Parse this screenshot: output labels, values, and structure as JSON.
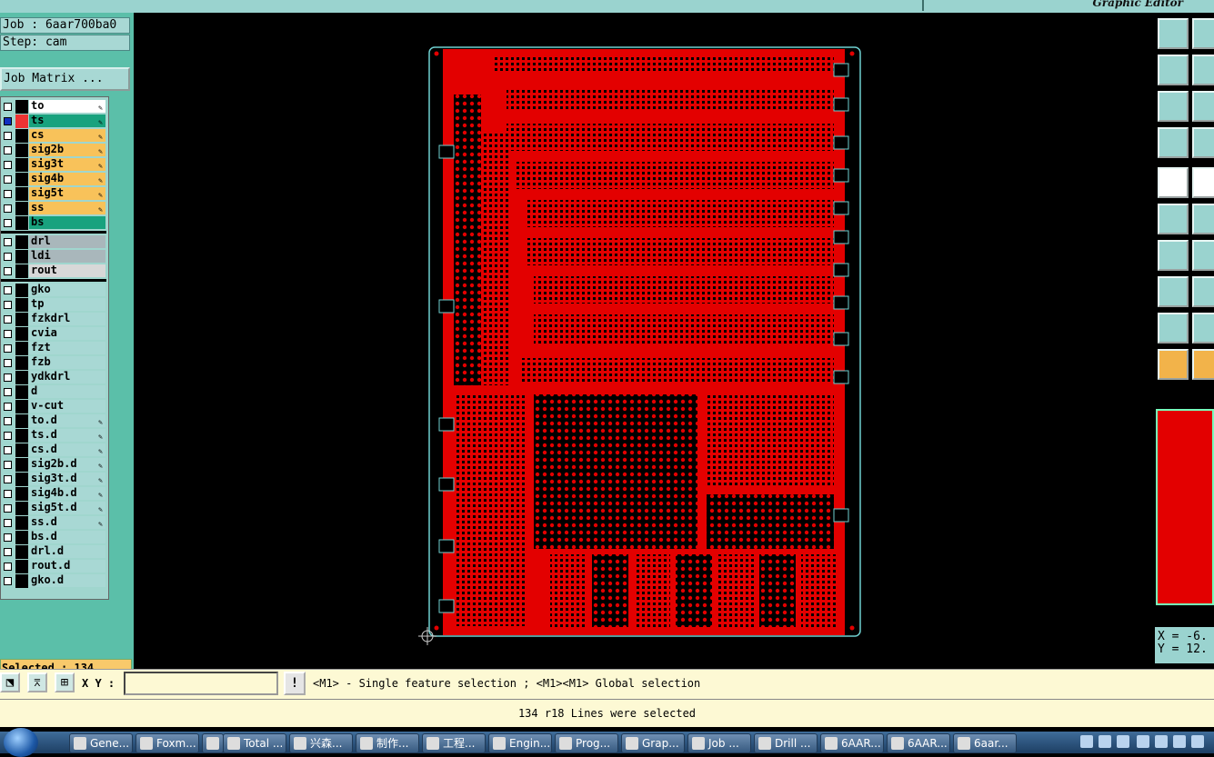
{
  "app": {
    "title": "Graphic Editor",
    "job": "Job : 6aar700ba0",
    "step": "Step: cam",
    "job_matrix": "Job Matrix ..."
  },
  "layers": {
    "board": [
      {
        "name": "to",
        "color": "#ffffff",
        "pen": true,
        "checked": false,
        "active": false
      },
      {
        "name": "ts",
        "color": "#18a27e",
        "pen": true,
        "checked": true,
        "active": true
      },
      {
        "name": "cs",
        "color": "#f8c25a",
        "pen": true,
        "checked": false,
        "active": false
      },
      {
        "name": "sig2b",
        "color": "#f8c25a",
        "pen": true,
        "checked": false,
        "active": false
      },
      {
        "name": "sig3t",
        "color": "#f8c25a",
        "pen": true,
        "checked": false,
        "active": false
      },
      {
        "name": "sig4b",
        "color": "#f8c25a",
        "pen": true,
        "checked": false,
        "active": false
      },
      {
        "name": "sig5t",
        "color": "#f8c25a",
        "pen": true,
        "checked": false,
        "active": false
      },
      {
        "name": "ss",
        "color": "#f8c25a",
        "pen": true,
        "checked": false,
        "active": false
      },
      {
        "name": "bs",
        "color": "#18a27e",
        "pen": false,
        "checked": false,
        "active": false
      }
    ],
    "drill": [
      {
        "name": "drl",
        "color": "#a9b7bb",
        "pen": false
      },
      {
        "name": "ldi",
        "color": "#a9b7bb",
        "pen": false
      },
      {
        "name": "rout",
        "color": "#d8d8d8",
        "pen": false
      }
    ],
    "misc": [
      {
        "name": "gko",
        "pen": false
      },
      {
        "name": "tp",
        "pen": false
      },
      {
        "name": "fzkdrl",
        "pen": false
      },
      {
        "name": "cvia",
        "pen": false
      },
      {
        "name": "fzt",
        "pen": false
      },
      {
        "name": "fzb",
        "pen": false
      },
      {
        "name": "ydkdrl",
        "pen": false
      },
      {
        "name": "d",
        "pen": false
      },
      {
        "name": "v-cut",
        "pen": false
      },
      {
        "name": "to.d",
        "pen": true
      },
      {
        "name": "ts.d",
        "pen": true
      },
      {
        "name": "cs.d",
        "pen": true
      },
      {
        "name": "sig2b.d",
        "pen": true
      },
      {
        "name": "sig3t.d",
        "pen": true
      },
      {
        "name": "sig4b.d",
        "pen": true
      },
      {
        "name": "sig5t.d",
        "pen": true
      },
      {
        "name": "ss.d",
        "pen": true
      },
      {
        "name": "bs.d",
        "pen": false
      },
      {
        "name": "drl.d",
        "pen": false
      },
      {
        "name": "rout.d",
        "pen": false
      },
      {
        "name": "gko.d",
        "pen": false
      }
    ]
  },
  "status": {
    "selected": "Selected : 134"
  },
  "coords": {
    "x": "X = -6.",
    "y": "Y = 12."
  },
  "command": {
    "xy_label": "X Y :",
    "xy_value": "",
    "warn": "!",
    "hint": "<M1> - Single feature selection ; <M1><M1> Global selection",
    "message": "134 r18 Lines were selected"
  },
  "colors": {
    "copper": "#e30000",
    "profile": "#6fd0d0",
    "panel": "#5bbfa9",
    "tool": "#9ad3cf"
  },
  "taskbar": [
    {
      "label": "Gene...",
      "icon": "gear-icon"
    },
    {
      "label": "Foxm...",
      "icon": "foxmail-icon"
    },
    {
      "label": "",
      "icon": "calculator-icon"
    },
    {
      "label": "Total ...",
      "icon": "floppy-icon"
    },
    {
      "label": "兴森...",
      "icon": "star-icon"
    },
    {
      "label": "制作...",
      "icon": "document-icon"
    },
    {
      "label": "工程...",
      "icon": "project-icon"
    },
    {
      "label": "Engin...",
      "icon": "x-window-icon"
    },
    {
      "label": "Prog...",
      "icon": "x-window-icon"
    },
    {
      "label": "Grap...",
      "icon": "x-window-icon"
    },
    {
      "label": "Job ...",
      "icon": "x-window-icon"
    },
    {
      "label": "Drill ...",
      "icon": "x-window-icon"
    },
    {
      "label": "6AAR...",
      "icon": "excel-icon"
    },
    {
      "label": "6AAR...",
      "icon": "excel-icon"
    },
    {
      "label": "6aar...",
      "icon": "notepad-icon"
    }
  ]
}
